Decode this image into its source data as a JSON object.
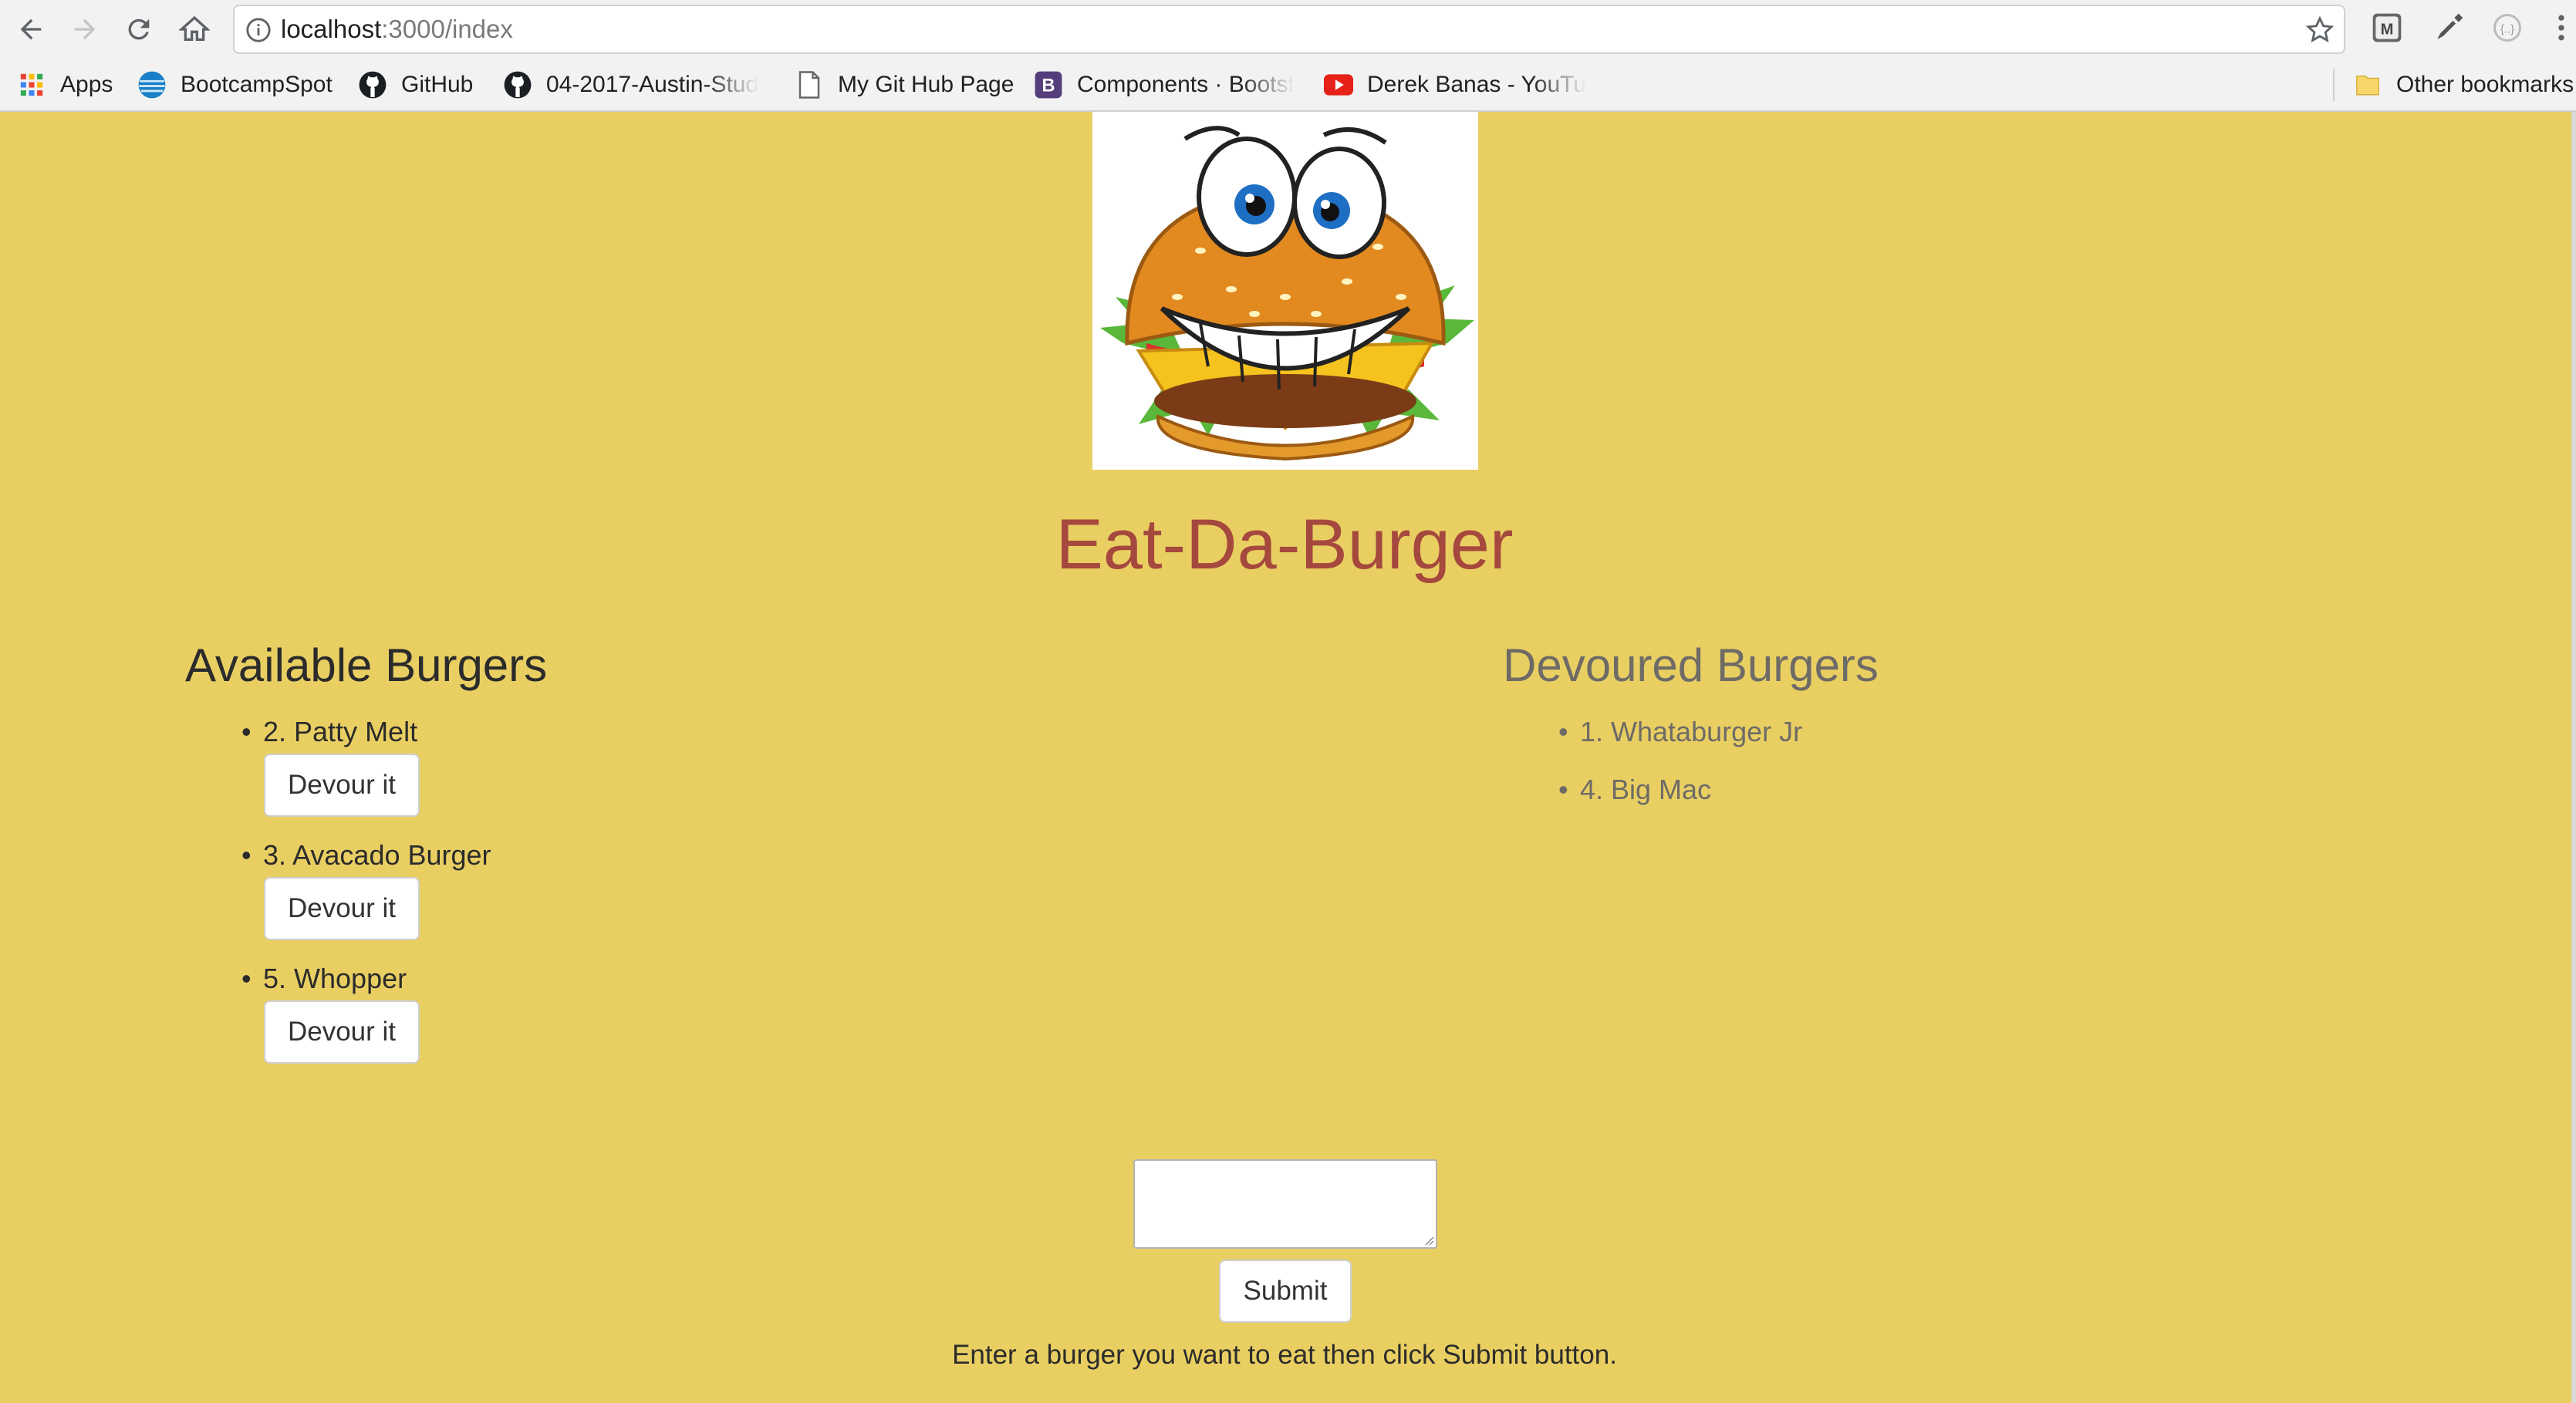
{
  "browser": {
    "url_host": "localhost",
    "url_path": ":3000/index",
    "bookmarks": [
      {
        "label": "Apps",
        "icon": "apps-grid-icon"
      },
      {
        "label": "BootcampSpot",
        "icon": "att-globe-icon"
      },
      {
        "label": "GitHub",
        "icon": "github-icon"
      },
      {
        "label": "04-2017-Austin-Stud",
        "icon": "github-icon"
      },
      {
        "label": "My Git Hub Page",
        "icon": "page-icon"
      },
      {
        "label": "Components · Bootst",
        "icon": "bootstrap-icon"
      },
      {
        "label": "Derek Banas - YouTu",
        "icon": "youtube-icon"
      },
      {
        "label": "Other bookmarks",
        "icon": "folder-icon"
      }
    ],
    "bootstrap_letter": "B"
  },
  "app": {
    "title": "Eat-Da-Burger",
    "available": {
      "heading": "Available Burgers",
      "items": [
        {
          "label": "2. Patty Melt",
          "button": "Devour it"
        },
        {
          "label": "3. Avacado Burger",
          "button": "Devour it"
        },
        {
          "label": "5. Whopper",
          "button": "Devour it"
        }
      ]
    },
    "devoured": {
      "heading": "Devoured Burgers",
      "items": [
        "1. Whataburger Jr",
        "4. Big Mac"
      ]
    },
    "form": {
      "input_value": "",
      "submit_label": "Submit",
      "instructions": "Enter a burger you want to eat then click Submit button."
    },
    "bullet": "•"
  },
  "colors": {
    "page_bg": "#e9cf62",
    "title": "#a5483e",
    "devoured_text": "#6e6b67",
    "chrome_bg": "#f2f2f2"
  }
}
